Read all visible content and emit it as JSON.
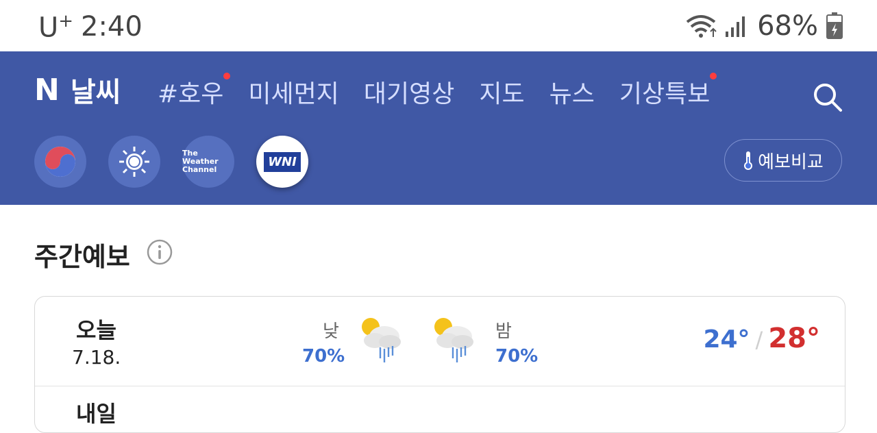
{
  "status_bar": {
    "carrier": "U",
    "carrier_plus": "+",
    "time": "2:40",
    "battery": "68%"
  },
  "header": {
    "brand_logo": "N",
    "brand_title": "날씨",
    "nav": [
      {
        "label": "#호우",
        "badge": true
      },
      {
        "label": "미세먼지",
        "badge": false
      },
      {
        "label": "대기영상",
        "badge": false
      },
      {
        "label": "지도",
        "badge": false
      },
      {
        "label": "뉴스",
        "badge": false
      },
      {
        "label": "기상특보",
        "badge": true
      }
    ],
    "search_icon": "search-icon",
    "sources": [
      {
        "name": "kma-logo-icon"
      },
      {
        "name": "sun-logo-icon"
      },
      {
        "text": "The Weather Channel"
      },
      {
        "text": "WNI",
        "selected": true
      }
    ],
    "compare_label": "예보비교",
    "compare_icon": "thermometer-icon"
  },
  "section": {
    "title": "주간예보",
    "info_icon": "info-icon"
  },
  "forecast": [
    {
      "day": "오늘",
      "date": "7.18.",
      "am_label": "낮",
      "am_precip": "70%",
      "am_icon": "partly-cloudy-rain-icon",
      "pm_label": "밤",
      "pm_precip": "70%",
      "pm_icon": "partly-cloudy-rain-icon",
      "low": "24°",
      "sep": "/",
      "high": "28°"
    },
    {
      "day": "내일"
    }
  ],
  "colors": {
    "header_bg": "#4058a5",
    "low_temp": "#3d6fcf",
    "high_temp": "#d22f2f",
    "badge": "#ff3d3d"
  }
}
